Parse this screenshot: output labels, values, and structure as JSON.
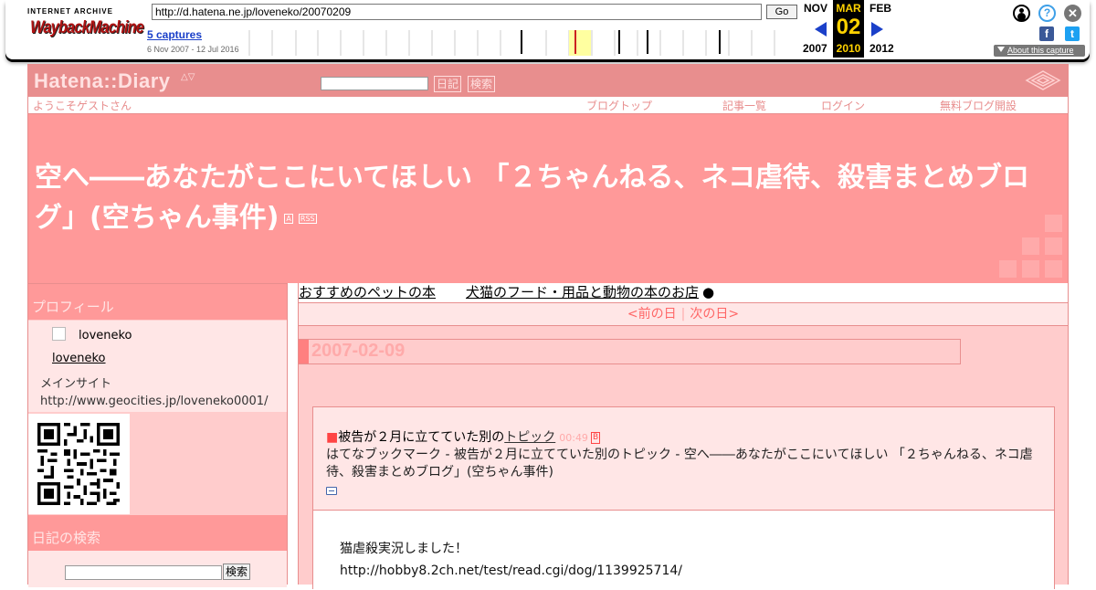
{
  "wayback": {
    "logo_top": "INTERNET ARCHIVE",
    "logo_main": "WaybackMachine",
    "url": "http://d.hatena.ne.jp/loveneko/20070209",
    "go_label": "Go",
    "captures": "5 captures",
    "capture_range": "6 Nov 2007 - 12 Jul 2016",
    "prev_month": "NOV",
    "prev_year": "2007",
    "cur_month": "MAR",
    "cur_day": "02",
    "cur_year": "2010",
    "next_month": "FEB",
    "next_year": "2012",
    "help_glyph": "?",
    "close_glyph": "✕",
    "facebook_glyph": "f",
    "twitter_glyph": "t",
    "about_label": "About this capture",
    "colors": {
      "accent_blue": "#1b40c9",
      "highlight": "#ffd200"
    }
  },
  "hatena": {
    "logo": "Hatena::Diary",
    "logo_arrows": "△▽",
    "search_diary_btn": "日記",
    "search_btn": "検索",
    "nav": {
      "welcome": "ようこそゲストさん",
      "blog_top": "ブログトップ",
      "article_list": "記事一覧",
      "login": "ログイン",
      "free_blog": "無料ブログ開設"
    },
    "title": "空へ――あなたがここにいてほしい 「２ちゃんねる、ネコ虐待、殺害まとめブログ」(空ちゃん事件)",
    "title_tag_a": "A",
    "title_tag_rss": "RSS",
    "colors": {
      "header": "#e88e8e",
      "title_bg": "#ff9999",
      "sidebar_bg": "#ffcccc"
    }
  },
  "sidebar": {
    "profile_heading": "プロフィール",
    "profile_name": "loveneko",
    "profile_link": "loveneko",
    "profile_site": "メインサイト http://www.geocities.jp/loveneko0001/",
    "search_heading": "日記の検索",
    "search_btn": "検索"
  },
  "main": {
    "ad_link1": "おすすめのペットの本",
    "ad_link2": "犬猫のフード・用品と動物の本のお店",
    "ad_bullet": "●",
    "prev_day": "<前の日",
    "nav_sep": "|",
    "next_day": "次の日>",
    "date": "2007-02-09",
    "section_marker": "■",
    "section_title_pre": "被告が２月に立てていた別の",
    "section_title_link": "トピック",
    "section_time": "00:49",
    "section_hb": "B",
    "bookmark_alt": "はてなブックマーク - 被告が２月に立てていた別のトピック - 空へ――あなたがここにいてほしい 「２ちゃんねる、ネコ虐待、殺害まとめブログ」(空ちゃん事件)",
    "body_line1": "猫虐殺実況しました！",
    "body_line2": "http://hobby8.2ch.net/test/read.cgi/dog/1139925714/"
  }
}
